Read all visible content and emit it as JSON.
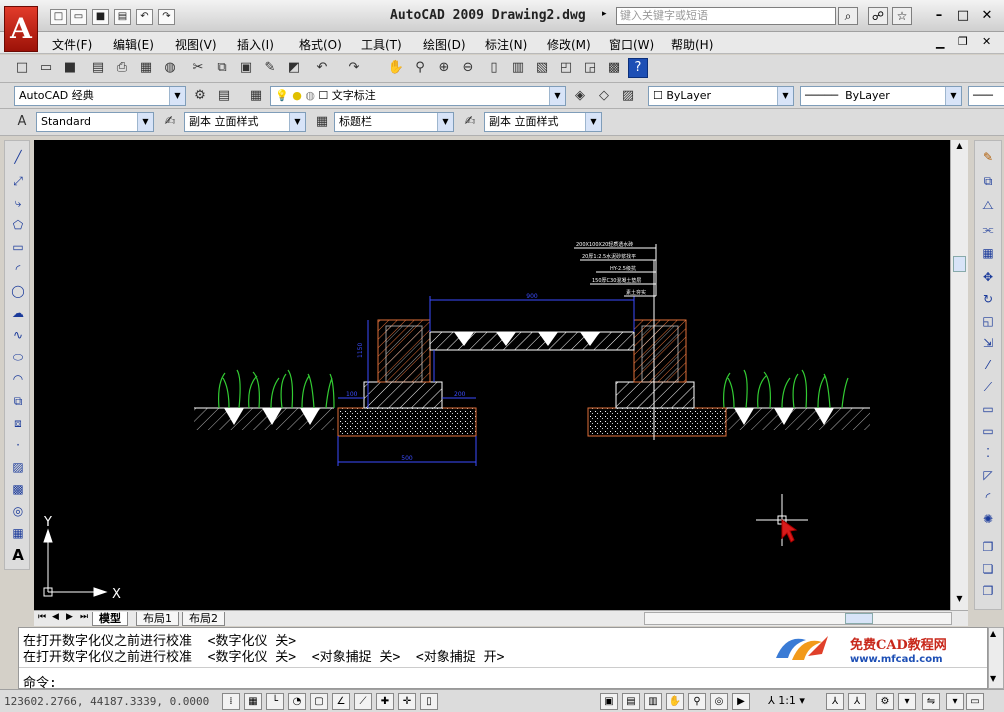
{
  "app": {
    "logo_letter": "A",
    "title": "AutoCAD 2009 Drawing2.dwg",
    "search_placeholder": "键入关键字或短语"
  },
  "menu": [
    "文件(F)",
    "编辑(E)",
    "视图(V)",
    "插入(I)",
    "格式(O)",
    "工具(T)",
    "绘图(D)",
    "标注(N)",
    "修改(M)",
    "窗口(W)",
    "帮助(H)"
  ],
  "toolbar2": {
    "workspace": "AutoCAD 经典",
    "layer": "文字标注",
    "color": "ByLayer",
    "linetype": "ByLayer"
  },
  "toolbar3": {
    "text_style": "Standard",
    "dim_style": "副本 立面样式",
    "table_style": "标题栏",
    "mleader_style": "副本 立面样式"
  },
  "canvas": {
    "ucs_x": "X",
    "ucs_y": "Y",
    "notes": [
      "200X100X20轻质透水砖",
      "20厚1:2.5水泥砂浆找平",
      "HY-2.5级抗",
      "150厚C30混凝土垫层",
      "素土夯实"
    ],
    "dim_top": "900",
    "dim_bottom": "500",
    "dim_left_h": "1150",
    "dim_left_base": "100",
    "dim_right_base": "200"
  },
  "tabs": [
    "模型",
    "布局1",
    "布局2"
  ],
  "command": {
    "line1": "在打开数字化仪之前进行校准  <数字化仪 关>",
    "line2": "在打开数字化仪之前进行校准  <数字化仪 关>  <对象捕捉 关>  <对象捕捉 开>",
    "prompt": "命令:"
  },
  "status": {
    "coords": "123602.2766, 44187.3339, 0.0000",
    "scale": "1:1"
  },
  "watermark": {
    "brand": "免费CAD教程网",
    "url": "www.mfcad.com"
  },
  "colors": {
    "canvas_bg": "#000000",
    "grass": "#33cc33",
    "hatch_orange": "#e0703a",
    "dim_blue": "#3b4cff",
    "logo_red": "#c8281b"
  }
}
